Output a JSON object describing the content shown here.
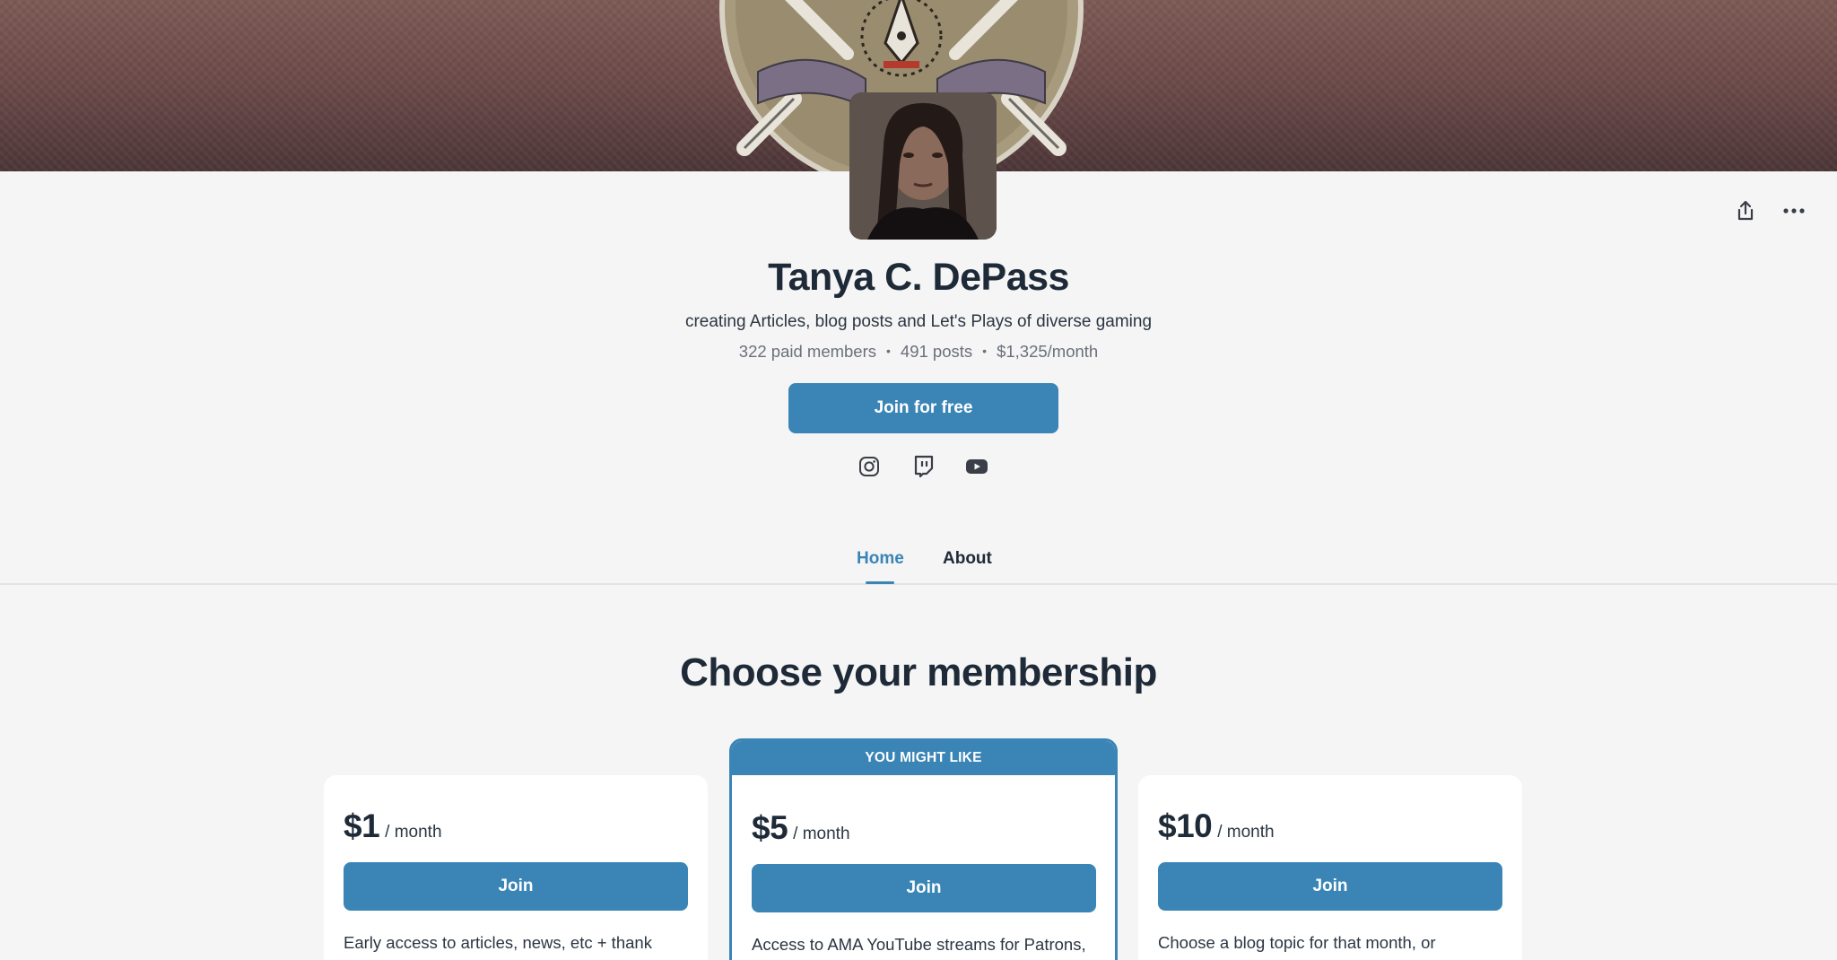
{
  "creator": {
    "name": "Tanya C. DePass",
    "tagline": "creating Articles, blog posts and Let's Plays of diverse gaming",
    "stats": {
      "members": "322 paid members",
      "posts": "491 posts",
      "earnings": "$1,325/month",
      "separator": "•"
    },
    "join_free_label": "Join for free"
  },
  "social": {
    "icons": [
      "instagram-icon",
      "twitch-icon",
      "youtube-icon"
    ]
  },
  "actions": {
    "icons": [
      "share-icon",
      "more-options-icon"
    ]
  },
  "tabs": [
    {
      "label": "Home",
      "active": true
    },
    {
      "label": "About",
      "active": false
    }
  ],
  "membership": {
    "title": "Choose your membership",
    "tiers": [
      {
        "price": "$1",
        "period": "/ month",
        "join_label": "Join",
        "description": "Early access to articles, news, etc + thank",
        "featured": false
      },
      {
        "badge": "YOU MIGHT LIKE",
        "price": "$5",
        "period": "/ month",
        "join_label": "Join",
        "description": "Access to AMA YouTube streams for Patrons,",
        "featured": true
      },
      {
        "price": "$10",
        "period": "/ month",
        "join_label": "Join",
        "description": "Choose a blog topic for that month, or",
        "featured": false
      }
    ]
  },
  "colors": {
    "accent": "#3a85b6",
    "heading": "#1e2a37",
    "background": "#f5f5f5",
    "banner": "#6b4a49"
  }
}
